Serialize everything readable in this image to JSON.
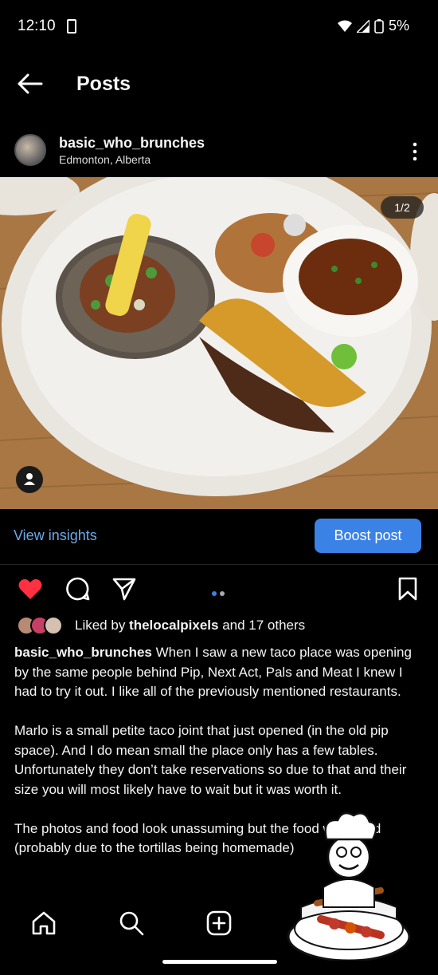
{
  "status_bar": {
    "time": "12:10",
    "battery": "5%"
  },
  "header": {
    "title": "Posts"
  },
  "post": {
    "username": "basic_who_brunches",
    "location": "Edmonton, Alberta",
    "image_counter": "1/2",
    "view_insights": "View insights",
    "boost_button": "Boost post",
    "likes": {
      "prefix": "Liked by ",
      "user": "thelocalpixels",
      "suffix": " and 17 others"
    },
    "caption": {
      "author": "basic_who_brunches",
      "p1": "When I saw a new taco place was opening by the same people behind Pip, Next Act, Pals and Meat I knew I had to try it out. I like all of the previously mentioned restaurants.",
      "p2": "Marlo is a small petite taco joint that just opened (in the old pip space). And I do mean small the place only has a few tables. Unfortunately they don’t take reservations so due to that and their size you will most likely have to wait but it was worth it.",
      "p3": "The photos and food look unassuming but the food was good (probably due to the tortillas being homemade)"
    }
  },
  "icons": [
    "back-arrow-icon",
    "more-options-icon",
    "like-heart-icon",
    "comment-icon",
    "share-icon",
    "save-bookmark-icon",
    "home-icon",
    "search-icon",
    "create-icon",
    "tag-people-icon"
  ],
  "colors": {
    "background": "#000000",
    "accent_blue": "#3b82e6",
    "link_blue": "#6ea8e8",
    "like_red": "#ff3040"
  }
}
